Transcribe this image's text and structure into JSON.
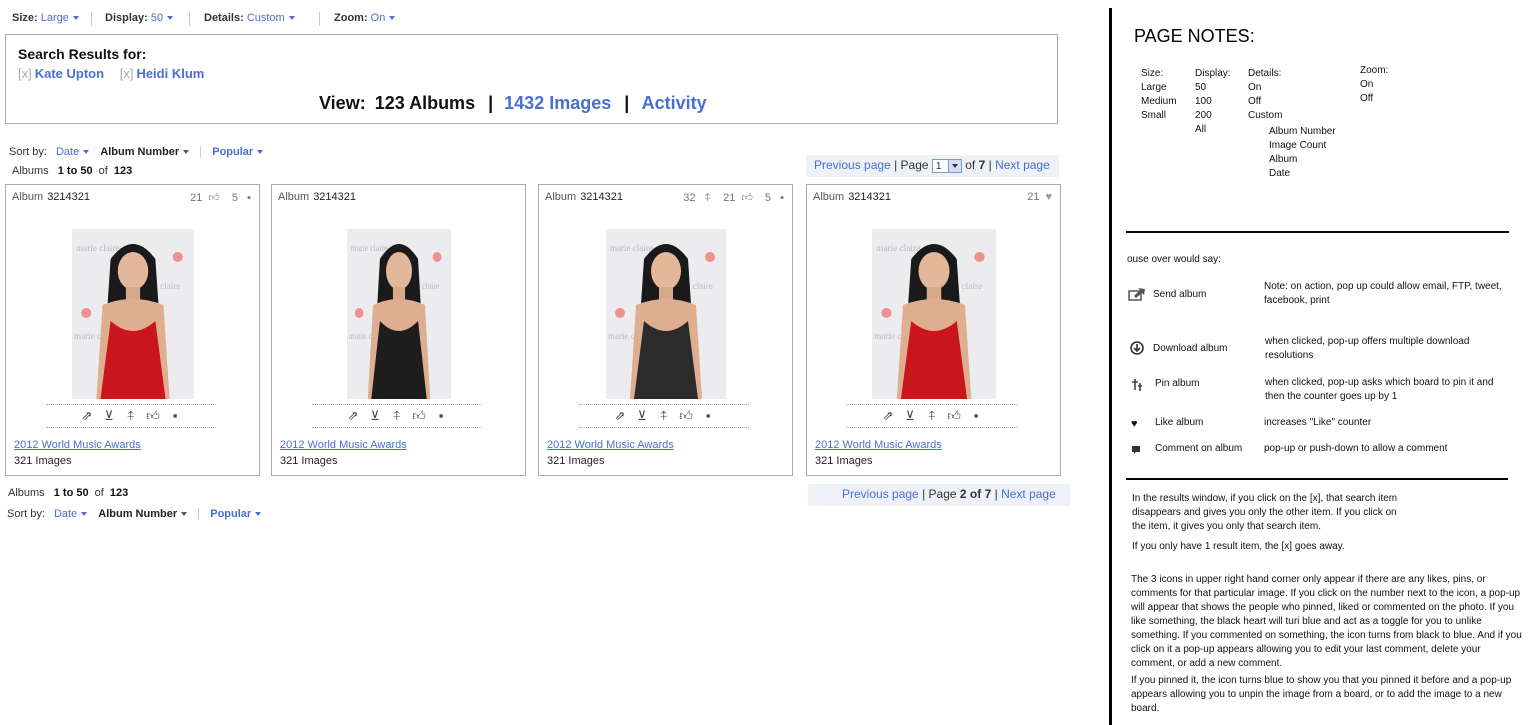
{
  "toolbar": {
    "size_label": "Size:",
    "size_value": "Large",
    "display_label": "Display:",
    "display_value": "50",
    "details_label": "Details:",
    "details_value": "Custom",
    "zoom_label": "Zoom:",
    "zoom_value": "On"
  },
  "search": {
    "title": "Search Results for:",
    "terms": [
      {
        "x": "[x]",
        "label": "Kate Upton"
      },
      {
        "x": "[x]",
        "label": "Heidi Klum"
      }
    ],
    "view_label": "View:",
    "albums": "123 Albums",
    "sep": "|",
    "images": "1432 Images",
    "activity": "Activity"
  },
  "sort": {
    "label": "Sort by:",
    "date": "Date",
    "album_number": "Album Number",
    "popular": "Popular"
  },
  "counter": {
    "prefix": "Albums",
    "range": "1 to 50",
    "of": "of",
    "total": "123"
  },
  "pager_top": {
    "prev": "Previous page",
    "page_label": "Page",
    "page_value": "1",
    "of": "of",
    "total": "7",
    "next": "Next page"
  },
  "pager_bottom": {
    "prev": "Previous page",
    "page_label": "Page",
    "page_value": "2",
    "of": "of",
    "total": "7",
    "next": "Next page"
  },
  "albums": [
    {
      "label": "Album",
      "number": "3214321",
      "pins": "",
      "likes": "21",
      "comments": "5",
      "title": "2012 World Music Awards",
      "count": "321 Images",
      "dress": "#c8161c"
    },
    {
      "label": "Album",
      "number": "3214321",
      "pins": "",
      "likes": "",
      "comments": "",
      "title": "2012 World Music Awards",
      "count": "321 Images",
      "dress": "#1d1d1d"
    },
    {
      "label": "Album",
      "number": "3214321",
      "pins": "32",
      "likes": "21",
      "comments": "5",
      "title": "2012 World Music Awards",
      "count": "321 Images",
      "dress": "#2b2b2b"
    },
    {
      "label": "Album",
      "number": "3214321",
      "pins": "",
      "likes": "21",
      "comments": "",
      "title": "2012 World Music Awards",
      "count": "321 Images",
      "dress": "#c8161c"
    }
  ],
  "notes": {
    "title": "PAGE NOTES:",
    "size": [
      "Size:",
      "Large",
      "Medium",
      "Small"
    ],
    "display": [
      "Display:",
      "50",
      "100",
      "200",
      "All"
    ],
    "details": [
      "Details:",
      "On",
      "Off",
      "Custom"
    ],
    "details_sub": [
      "Album Number",
      "Image Count",
      "Album",
      "Date"
    ],
    "zoom": [
      "Zoom:",
      "On",
      "Off"
    ],
    "mouseover": "ouse over would say:",
    "legend": [
      {
        "label": "Send  album",
        "desc": "Note: on action, pop up could allow email, FTP, tweet, facebook, print"
      },
      {
        "label": "Download  album",
        "desc": "when clicked, pop-up offers multiple download resolutions"
      },
      {
        "label": "Pin  album",
        "desc": "when clicked, pop-up asks which board to pin it  and then the counter goes up by 1"
      },
      {
        "label": "Like  album",
        "desc": "increases \"Like\" counter"
      },
      {
        "label": "Comment on  album",
        "desc": "pop-up or push-down to allow a comment"
      }
    ],
    "para1": "In the results window, if you click on the [x], that search item disappears and gives you only the other item.  If you click on the item, it gives you only that search item.",
    "para2": "If you only have 1 result item, the [x] goes away.",
    "para3": "The 3 icons in upper right hand corner only appear if there are any likes, pins, or comments for that particular image.  If you click on the number next to the icon, a pop-up will appear that shows the people who pinned, liked or commented on the photo.  If you like something, the black heart will turi blue and act as a toggle for you to unlike something.  If you commented on something, the icon turns from black to blue.  And if you click on it a pop-up appears allowing you to edit your last comment, delete your comment, or add a new comment.",
    "para4": "If you pinned it, the icon turns   blue  to show you that you pinned it before and a pop-up appears allowing you to unpin the image from a board, or to add the image to a new board."
  }
}
